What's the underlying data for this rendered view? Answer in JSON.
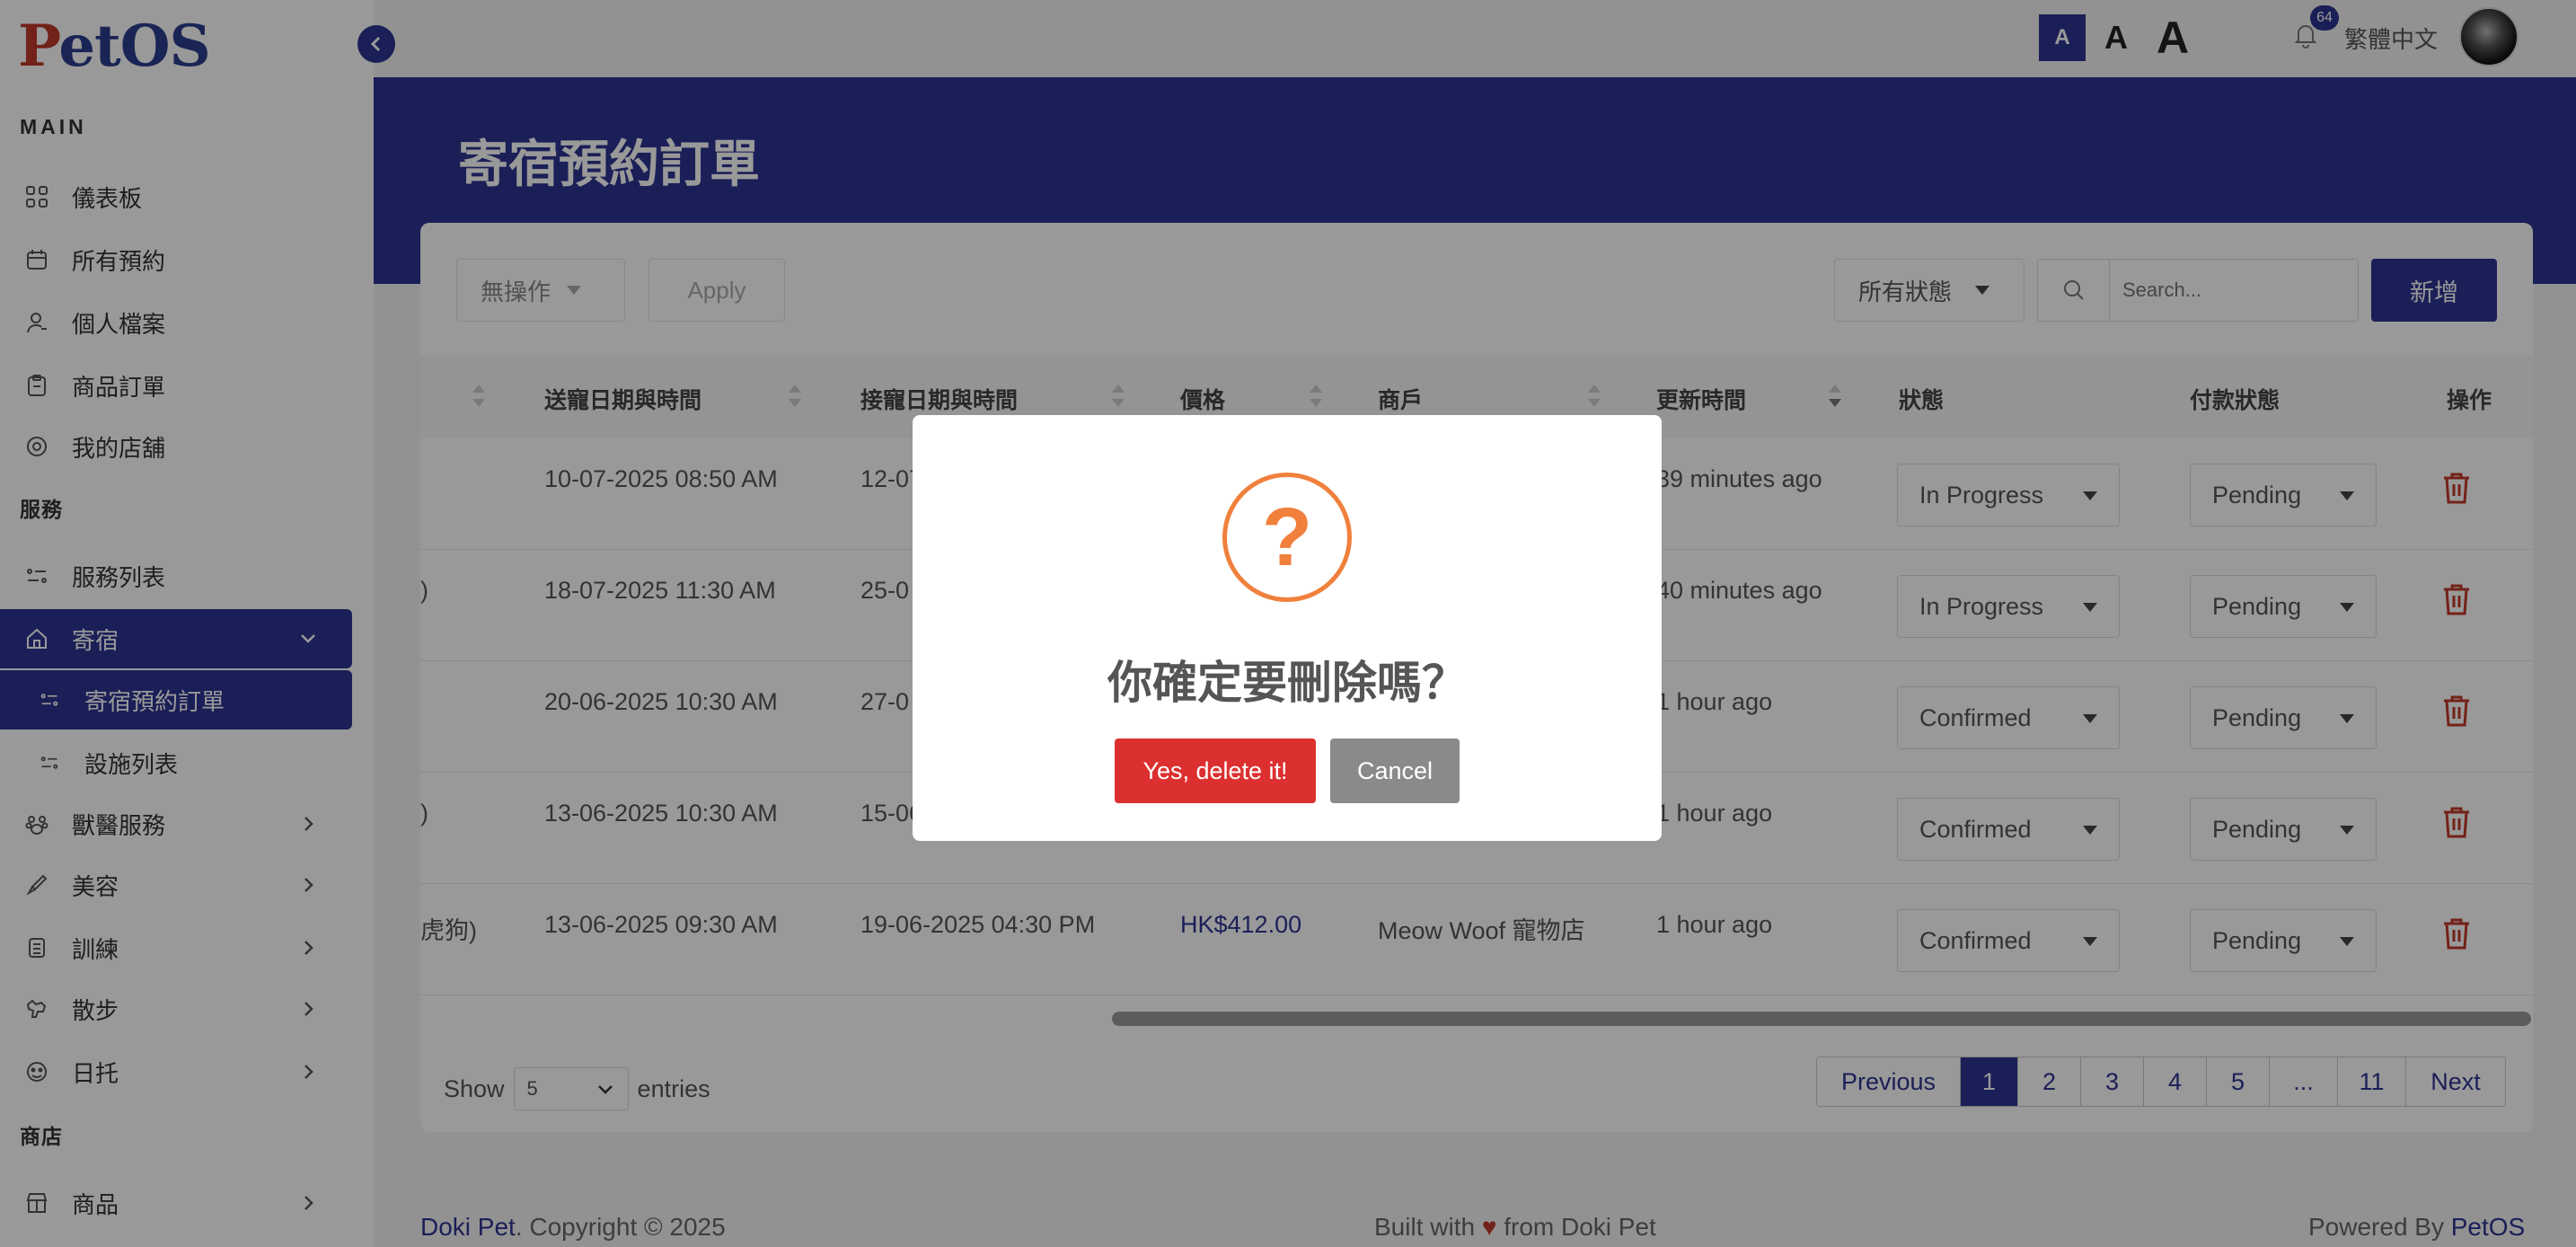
{
  "app": {
    "logo_p": "P",
    "logo_rest": "etOS"
  },
  "topbar": {
    "font_small": "A",
    "font_medium": "A",
    "font_large": "A",
    "notification_count": "64",
    "language": "繁體中文"
  },
  "sidebar": {
    "section_main": "MAIN",
    "section_services": "服務",
    "section_shop": "商店",
    "items": [
      {
        "label": "儀表板",
        "icon": "grid-icon"
      },
      {
        "label": "所有預約",
        "icon": "calendar-icon"
      },
      {
        "label": "個人檔案",
        "icon": "user-icon"
      },
      {
        "label": "商品訂單",
        "icon": "clipboard-icon"
      },
      {
        "label": "我的店舖",
        "icon": "store-icon"
      },
      {
        "label": "服務列表",
        "icon": "list-icon"
      },
      {
        "label": "寄宿",
        "icon": "home-icon"
      },
      {
        "label": "寄宿預約訂單",
        "icon": "list-icon"
      },
      {
        "label": "設施列表",
        "icon": "list-icon"
      },
      {
        "label": "獸醫服務",
        "icon": "paw-icon"
      },
      {
        "label": "美容",
        "icon": "brush-icon"
      },
      {
        "label": "訓練",
        "icon": "training-icon"
      },
      {
        "label": "散步",
        "icon": "walk-icon"
      },
      {
        "label": "日托",
        "icon": "daycare-icon"
      },
      {
        "label": "商品",
        "icon": "shop-icon"
      }
    ]
  },
  "page": {
    "title": "寄宿預約訂單"
  },
  "toolbar": {
    "bulk_action": "無操作",
    "apply": "Apply",
    "status_filter": "所有狀態",
    "search_placeholder": "Search...",
    "add": "新增"
  },
  "table": {
    "headers": [
      "送寵日期與時間",
      "接寵日期與時間",
      "價格",
      "商戶",
      "更新時間",
      "狀態",
      "付款狀態",
      "操作"
    ],
    "rows": [
      {
        "lead": "",
        "dropoff": "10-07-2025 08:50 AM",
        "pickup": "12-07",
        "price": "",
        "merchant": "",
        "updated": "39 minutes ago",
        "status": "In Progress",
        "payment": "Pending"
      },
      {
        "lead": ")",
        "dropoff": "18-07-2025 11:30 AM",
        "pickup": "25-0",
        "price": "",
        "merchant": "",
        "updated": "40 minutes ago",
        "status": "In Progress",
        "payment": "Pending"
      },
      {
        "lead": "",
        "dropoff": "20-06-2025 10:30 AM",
        "pickup": "27-0",
        "price": "",
        "merchant": "",
        "updated": "1 hour ago",
        "status": "Confirmed",
        "payment": "Pending"
      },
      {
        "lead": ")",
        "dropoff": "13-06-2025 10:30 AM",
        "pickup": "15-06",
        "price": "",
        "merchant": "",
        "updated": "1 hour ago",
        "status": "Confirmed",
        "payment": "Pending"
      },
      {
        "lead": "虎狗)",
        "dropoff": "13-06-2025 09:30 AM",
        "pickup": "19-06-2025 04:30 PM",
        "price": "HK$412.00",
        "merchant": "Meow Woof 寵物店",
        "updated": "1 hour ago",
        "status": "Confirmed",
        "payment": "Pending"
      }
    ]
  },
  "pagination": {
    "show": "Show",
    "entries_value": "5",
    "entries": "entries",
    "previous": "Previous",
    "pages": [
      "1",
      "2",
      "3",
      "4",
      "5",
      "...",
      "11"
    ],
    "next": "Next"
  },
  "footer": {
    "brand": "Doki Pet",
    "copyright": ". Copyright © 2025",
    "built_with": "Built with",
    "from": "from Doki Pet",
    "powered_by": "Powered By",
    "powered_brand": "PetOS"
  },
  "modal": {
    "icon": "?",
    "title": "你確定要刪除嗎？",
    "confirm": "Yes, delete it!",
    "cancel": "Cancel"
  },
  "colors": {
    "primary": "#2e3591",
    "danger": "#dc3030",
    "warning": "#f0803c"
  }
}
